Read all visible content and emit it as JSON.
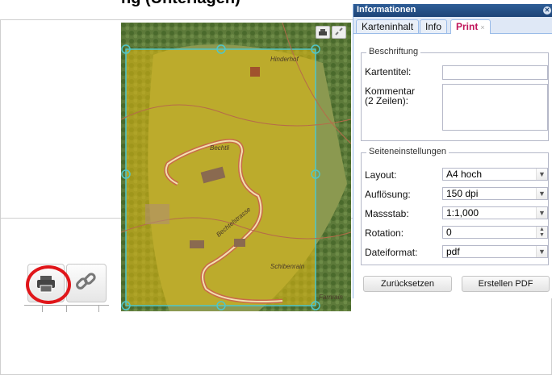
{
  "heading": {
    "text": "ng (Unterlagen)"
  },
  "map": {
    "labels": [
      "Hinderhof",
      "Bechtli",
      "Bechtelstrasse",
      "Schibenrain",
      "Farnrain"
    ],
    "tools": [
      "print-icon",
      "link-icon"
    ]
  },
  "toolbar_zoom": {
    "icons": [
      "print-icon",
      "link-icon"
    ]
  },
  "panel": {
    "title": "Informationen",
    "tabs": [
      {
        "label": "Karteninhalt"
      },
      {
        "label": "Info"
      },
      {
        "label": "Print",
        "close": "×"
      }
    ],
    "beschriftung": {
      "legend": "Beschriftung",
      "kartentitel_label": "Kartentitel:",
      "kartentitel_value": "",
      "kommentar_label_1": "Kommentar",
      "kommentar_label_2": "(2 Zeilen):",
      "kommentar_value": ""
    },
    "seiteneinstellungen": {
      "legend": "Seiteneinstellungen",
      "layout_label": "Layout:",
      "layout_value": "A4 hoch",
      "aufloesung_label": "Auflösung:",
      "aufloesung_value": "150 dpi",
      "massstab_label": "Massstab:",
      "massstab_value": "1:1,000",
      "rotation_label": "Rotation:",
      "rotation_value": "0",
      "dateiformat_label": "Dateiformat:",
      "dateiformat_value": "pdf"
    },
    "buttons": {
      "reset": "Zurücksetzen",
      "create": "Erstellen PDF"
    }
  },
  "colors": {
    "print_frame": "#4fc6c9",
    "print_fill": "#e6b90e",
    "accent_tab": "#c0145a",
    "highlight_ring": "#e0161a"
  }
}
